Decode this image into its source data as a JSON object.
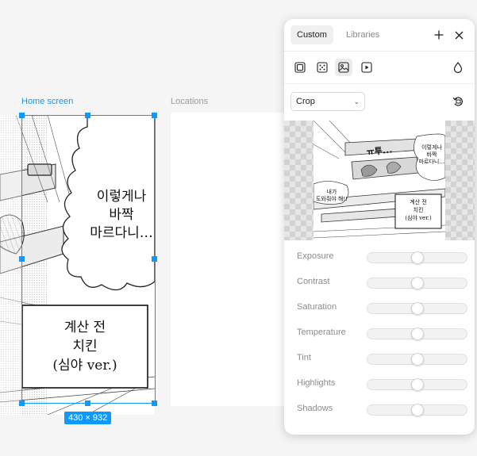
{
  "canvas": {
    "frames": [
      {
        "label": "Home screen"
      },
      {
        "label": "Locations"
      }
    ],
    "selection_size": "430 × 932",
    "artwork": {
      "bubble_text": [
        "이렇게나",
        "바짝",
        "마르다니…"
      ],
      "caption_box": [
        "계산 전",
        "치킨",
        "(심야 ver.)"
      ],
      "preview_sfx": "ㅠ투...",
      "preview_bubble_right": [
        "이렇게나",
        "바짝",
        "마르다니…"
      ],
      "preview_bubble_left": [
        "내가",
        "도와줘야 해!!"
      ],
      "preview_caption": [
        "계산 전",
        "치킨",
        "(심야 ver.)"
      ]
    }
  },
  "panel": {
    "tabs": [
      {
        "label": "Custom",
        "active": true
      },
      {
        "label": "Libraries",
        "active": false
      }
    ],
    "header_icons": [
      "plus-icon",
      "close-icon"
    ],
    "fill_types": [
      "solid-fill-icon",
      "gradient-fill-icon",
      "image-fill-icon",
      "video-fill-icon"
    ],
    "opacity_icon": "drop-icon",
    "crop_select": {
      "value": "Crop"
    },
    "rotate_icon": "rotate-icon",
    "adjustments": [
      {
        "label": "Exposure",
        "value": 0.5
      },
      {
        "label": "Contrast",
        "value": 0.5
      },
      {
        "label": "Saturation",
        "value": 0.5
      },
      {
        "label": "Temperature",
        "value": 0.5
      },
      {
        "label": "Tint",
        "value": 0.5
      },
      {
        "label": "Highlights",
        "value": 0.5
      },
      {
        "label": "Shadows",
        "value": 0.5
      }
    ]
  },
  "colors": {
    "accent": "#0d99ff"
  }
}
